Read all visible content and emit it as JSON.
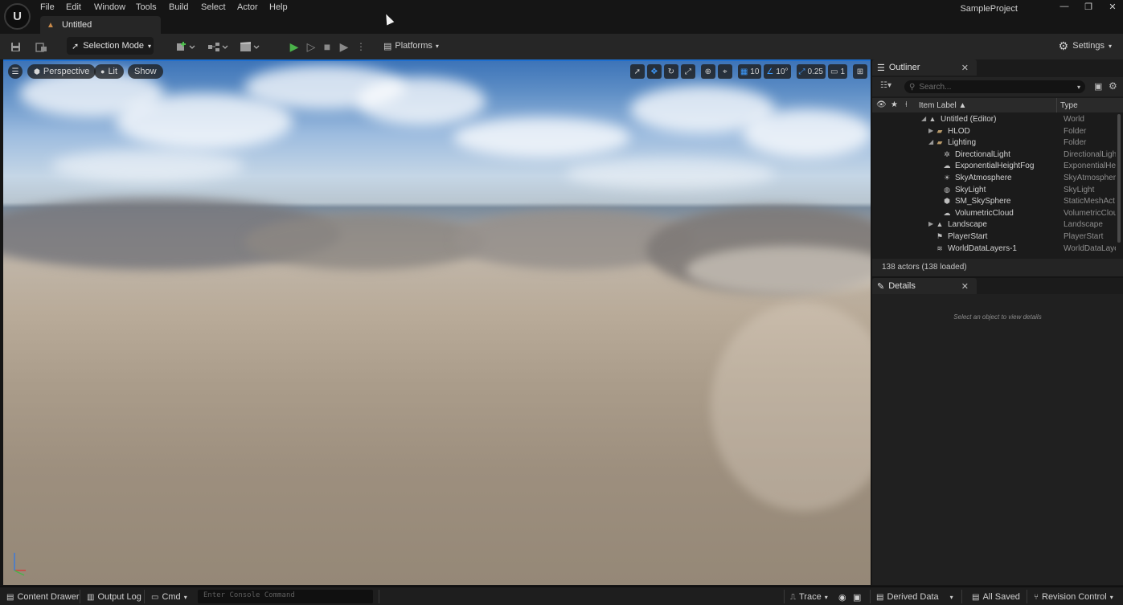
{
  "app": {
    "project_name": "SampleProject",
    "document_tab": "Untitled",
    "logo_text": "U"
  },
  "menu": [
    "File",
    "Edit",
    "Window",
    "Tools",
    "Build",
    "Select",
    "Actor",
    "Help"
  ],
  "toolbar": {
    "selection_mode": "Selection Mode",
    "platforms": "Platforms",
    "settings": "Settings"
  },
  "viewport": {
    "perspective": "Perspective",
    "lit": "Lit",
    "show": "Show",
    "grid_snap": "10",
    "rotation_snap": "10°",
    "scale_snap": "0.25",
    "camera_speed": "1",
    "accent": "#3d9bff"
  },
  "outliner": {
    "title": "Outliner",
    "search_placeholder": "Search...",
    "col_label": "Item Label ▲",
    "col_type": "Type",
    "rows": [
      {
        "label": "Untitled (Editor)",
        "type": "World"
      },
      {
        "label": "HLOD",
        "type": "Folder"
      },
      {
        "label": "Lighting",
        "type": "Folder"
      },
      {
        "label": "DirectionalLight",
        "type": "DirectionalLigh"
      },
      {
        "label": "ExponentialHeightFog",
        "type": "ExponentialHei"
      },
      {
        "label": "SkyAtmosphere",
        "type": "SkyAtmospher"
      },
      {
        "label": "SkyLight",
        "type": "SkyLight"
      },
      {
        "label": "SM_SkySphere",
        "type": "StaticMeshAct"
      },
      {
        "label": "VolumetricCloud",
        "type": "VolumetricClou"
      },
      {
        "label": "Landscape",
        "type": "Landscape"
      },
      {
        "label": "PlayerStart",
        "type": "PlayerStart"
      },
      {
        "label": "WorldDataLayers-1",
        "type": "WorldDataLaye"
      }
    ],
    "footer": "138 actors (138 loaded)"
  },
  "details": {
    "title": "Details",
    "empty_text": "Select an object to view details"
  },
  "statusbar": {
    "content_drawer": "Content Drawer",
    "output_log": "Output Log",
    "cmd": "Cmd",
    "console_placeholder": "Enter Console Command",
    "trace": "Trace",
    "derived_data": "Derived Data",
    "all_saved": "All Saved",
    "revision_control": "Revision Control"
  }
}
